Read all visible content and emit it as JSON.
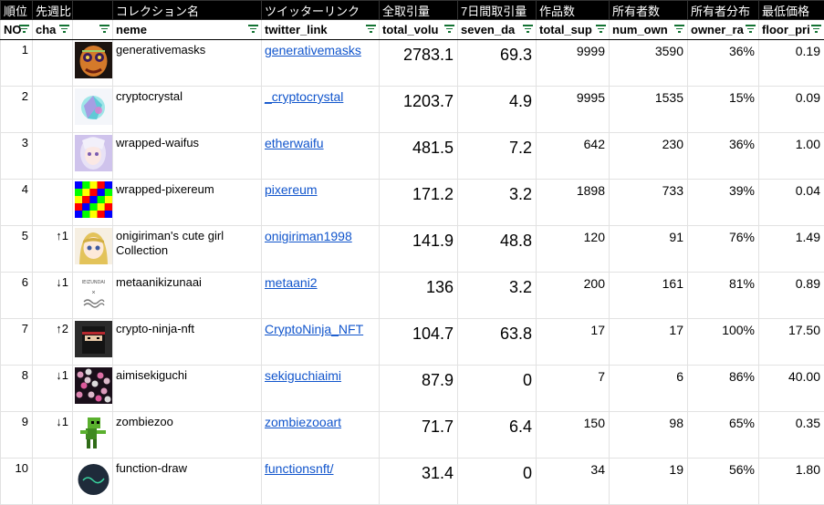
{
  "header_jp": [
    "順位",
    "先週比",
    "",
    "コレクション名",
    "ツイッターリンク",
    "全取引量",
    "7日間取引量",
    "作品数",
    "所有者数",
    "所有者分布",
    "最低価格"
  ],
  "header_en": [
    "NO",
    "cha",
    "",
    "neme",
    "twitter_link",
    "total_volu",
    "seven_da",
    "total_sup",
    "num_own",
    "owner_ra",
    "floor_pri"
  ],
  "rows": [
    {
      "rank": "1",
      "change": "",
      "name": "generativemasks",
      "twitter": "generativemasks",
      "total_volume": "2783.1",
      "seven_day": "69.3",
      "total_supply": "9999",
      "num_owners": "3590",
      "owner_ratio": "36%",
      "floor_price": "0.19",
      "thumb": "mask-icon"
    },
    {
      "rank": "2",
      "change": "",
      "name": "cryptocrystal",
      "twitter": "_cryptocrystal",
      "total_volume": "1203.7",
      "seven_day": "4.9",
      "total_supply": "9995",
      "num_owners": "1535",
      "owner_ratio": "15%",
      "floor_price": "0.09",
      "thumb": "crystal-icon"
    },
    {
      "rank": "3",
      "change": "",
      "name": "wrapped-waifus",
      "twitter": "etherwaifu",
      "total_volume": "481.5",
      "seven_day": "7.2",
      "total_supply": "642",
      "num_owners": "230",
      "owner_ratio": "36%",
      "floor_price": "1.00",
      "thumb": "waifu-icon"
    },
    {
      "rank": "4",
      "change": "",
      "name": "wrapped-pixereum",
      "twitter": "pixereum",
      "total_volume": "171.2",
      "seven_day": "3.2",
      "total_supply": "1898",
      "num_owners": "733",
      "owner_ratio": "39%",
      "floor_price": "0.04",
      "thumb": "pixel-icon"
    },
    {
      "rank": "5",
      "change": "↑1",
      "name": "onigiriman's cute girl Collection",
      "twitter": "onigiriman1998",
      "total_volume": "141.9",
      "seven_day": "48.8",
      "total_supply": "120",
      "num_owners": "91",
      "owner_ratio": "76%",
      "floor_price": "1.49",
      "thumb": "girl-icon"
    },
    {
      "rank": "6",
      "change": "↓1",
      "name": "metaanikizunaai",
      "twitter": "metaani2",
      "total_volume": "136",
      "seven_day": "3.2",
      "total_supply": "200",
      "num_owners": "161",
      "owner_ratio": "81%",
      "floor_price": "0.89",
      "thumb": "metaani-icon"
    },
    {
      "rank": "7",
      "change": "↑2",
      "name": "crypto-ninja-nft",
      "twitter": "CryptoNinja_NFT",
      "total_volume": "104.7",
      "seven_day": "63.8",
      "total_supply": "17",
      "num_owners": "17",
      "owner_ratio": "100%",
      "floor_price": "17.50",
      "thumb": "ninja-icon"
    },
    {
      "rank": "8",
      "change": "↓1",
      "name": "aimisekiguchi",
      "twitter": "sekiguchiaimi",
      "total_volume": "87.9",
      "seven_day": "0",
      "total_supply": "7",
      "num_owners": "6",
      "owner_ratio": "86%",
      "floor_price": "40.00",
      "thumb": "bokeh-icon"
    },
    {
      "rank": "9",
      "change": "↓1",
      "name": "zombiezoo",
      "twitter": "zombiezooart",
      "total_volume": "71.7",
      "seven_day": "6.4",
      "total_supply": "150",
      "num_owners": "98",
      "owner_ratio": "65%",
      "floor_price": "0.35",
      "thumb": "zombie-icon"
    },
    {
      "rank": "10",
      "change": "",
      "name": "function-draw",
      "twitter": "functionsnft/",
      "total_volume": "31.4",
      "seven_day": "0",
      "total_supply": "34",
      "num_owners": "19",
      "owner_ratio": "56%",
      "floor_price": "1.80",
      "thumb": "function-icon"
    }
  ],
  "thumb_text": {
    "metaani": "IEIZUNDAI"
  },
  "colors": {
    "header_bg": "#000000",
    "link": "#1155cc",
    "filter_icon": "#137333"
  }
}
